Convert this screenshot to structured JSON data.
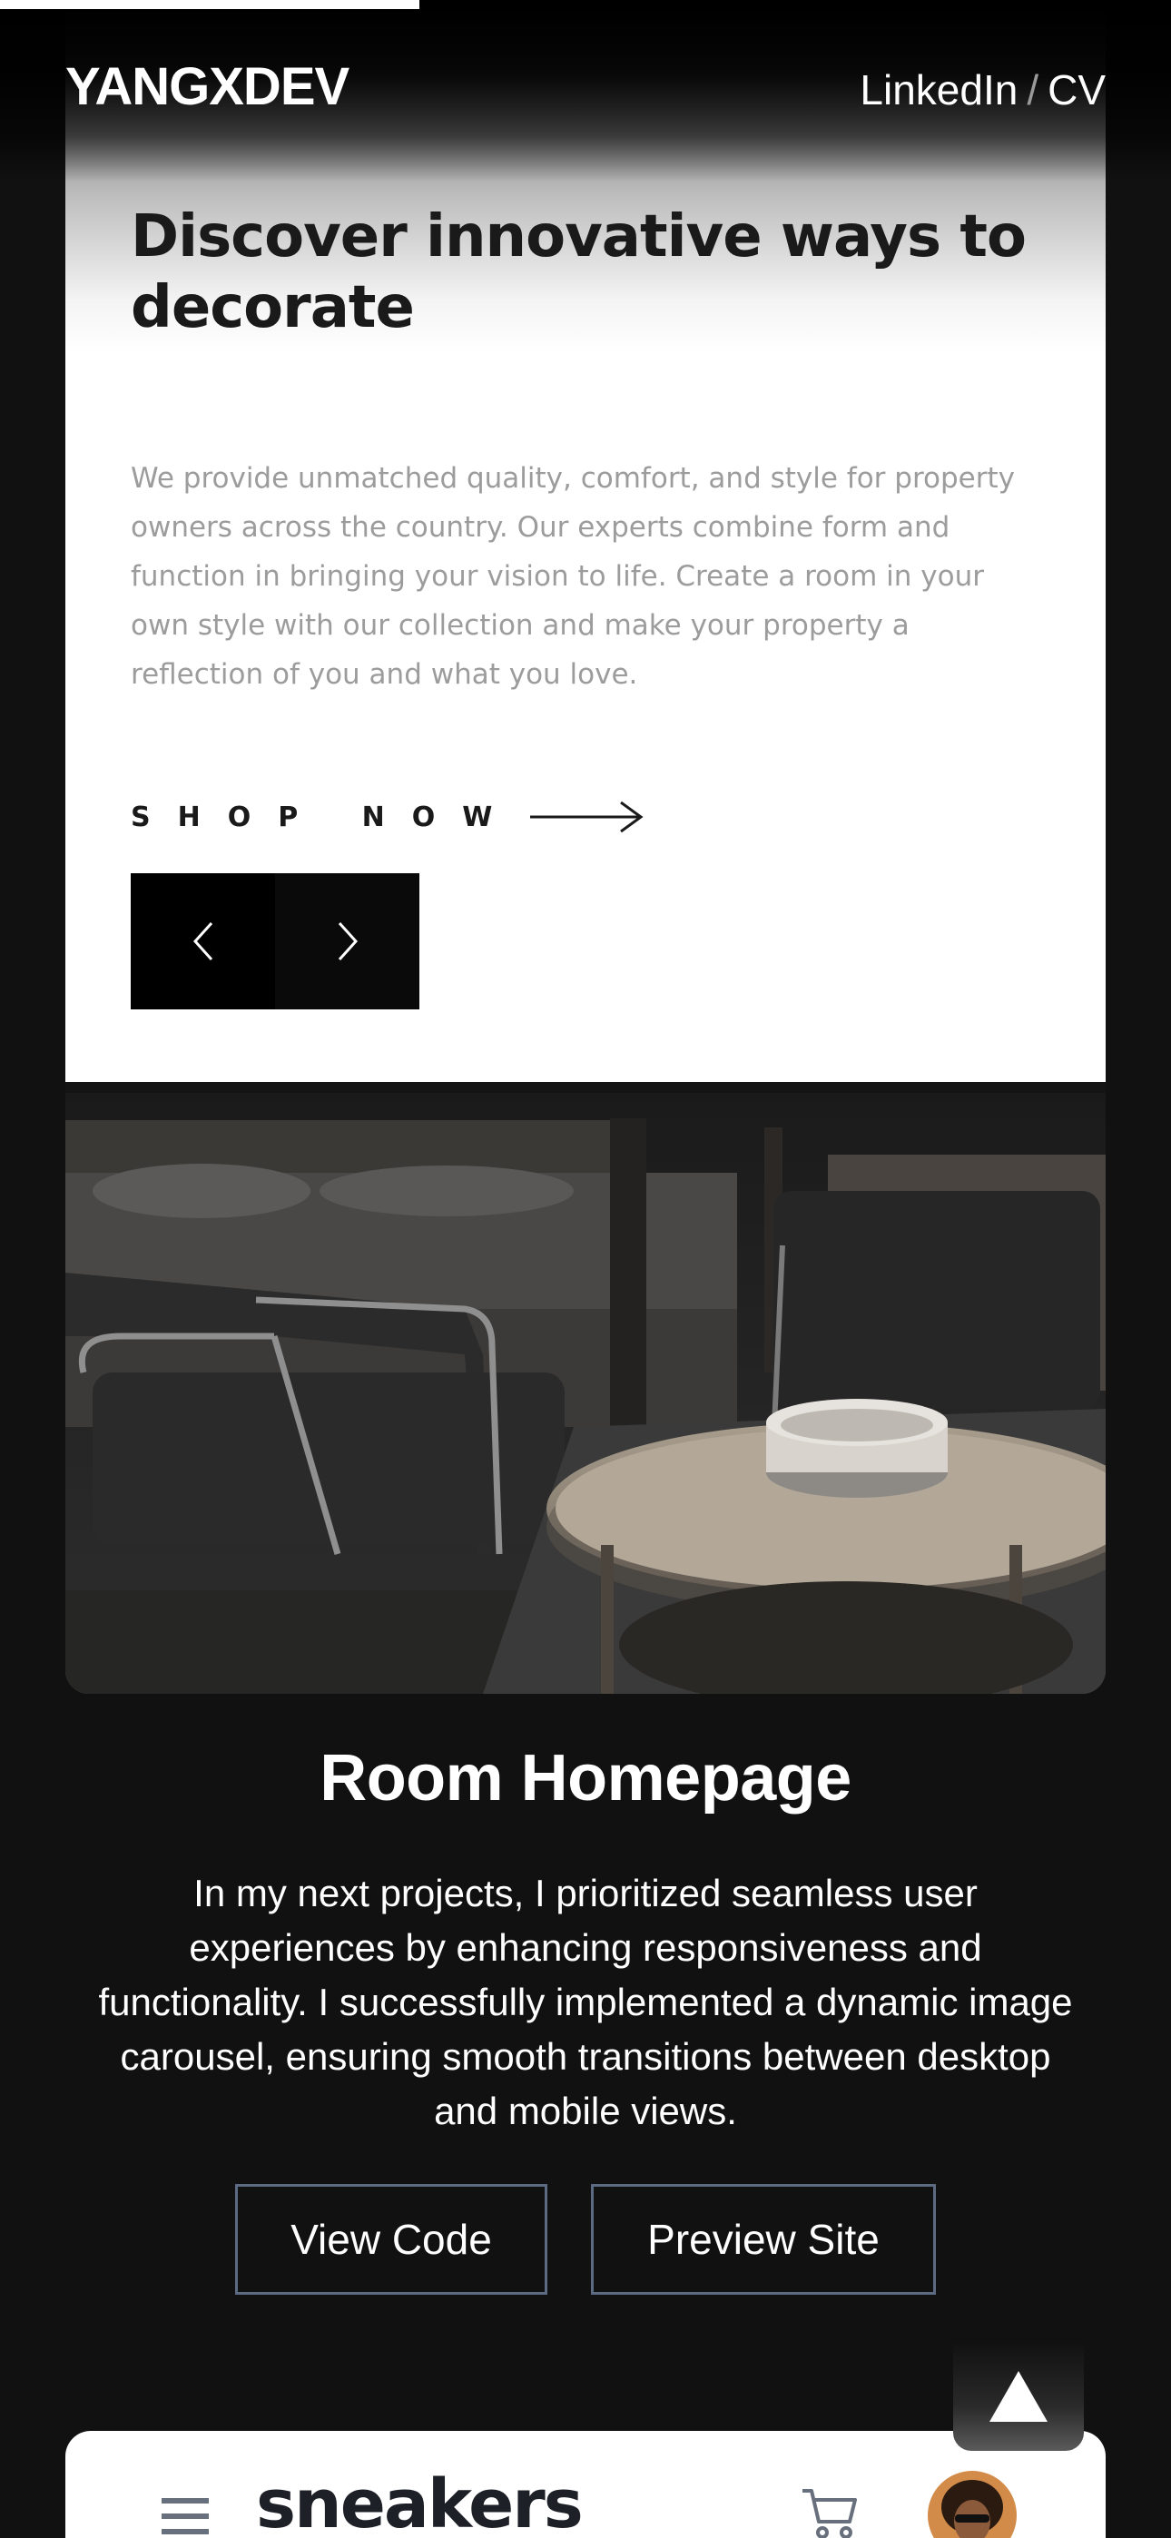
{
  "progress": {
    "value_percent": 35.8
  },
  "header": {
    "brand": "YANGXDEV",
    "links": [
      {
        "label": "LinkedIn"
      },
      {
        "label": "CV"
      }
    ],
    "separator": "/"
  },
  "preview": {
    "heading": "Discover innovative ways to decorate",
    "body": "We provide unmatched quality, comfort, and style for property owners across the country. Our experts combine form and function in bringing your vision to life. Create a room in your own style with our collection and make your property a reflection of you and what you love.",
    "cta": "SHOP NOW",
    "icons": {
      "arrow": "arrow-right-icon",
      "prev": "chevron-left-icon",
      "next": "chevron-right-icon"
    }
  },
  "project": {
    "title": "Room Homepage",
    "description": "In my next projects, I prioritized seamless user experiences by enhancing responsiveness and functionality. I successfully implemented a dynamic image carousel, ensuring smooth transitions between desktop and mobile views.",
    "buttons": {
      "view_code": "View Code",
      "preview_site": "Preview Site"
    }
  },
  "back_to_top": {
    "icon": "triangle-up-icon"
  },
  "next_project": {
    "logo": "sneakers",
    "icons": {
      "menu": "hamburger-menu-icon",
      "cart": "cart-icon",
      "avatar": "avatar"
    }
  },
  "colors": {
    "page_bg": "#111111",
    "button_border": "#5d6b82",
    "text": "#ffffff"
  }
}
